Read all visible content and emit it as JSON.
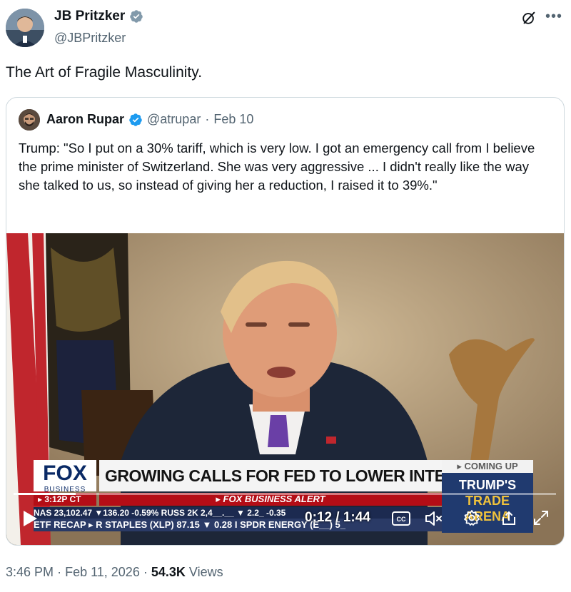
{
  "author": {
    "display_name": "JB Pritzker",
    "handle": "@JBPritzker"
  },
  "tweet": {
    "text": "The Art of Fragile Masculinity."
  },
  "quoted": {
    "display_name": "Aaron Rupar",
    "handle": "@atrupar",
    "separator": "·",
    "date": "Feb 10",
    "text": "Trump: \"So I put on a 30% tariff, which is very low. I got an emergency call from I believe the prime minister of Switzerland. She was very aggressive ... I didn't really like the way she talked to us, so instead of giving her a reduction, I raised it to 39%.\""
  },
  "video": {
    "overlay": {
      "logo": "FOX",
      "logo_sub": "BUSINESS",
      "headline": "GROWING CALLS FOR FED TO LOWER INTEREST RATES",
      "time": "▸ 3:12P CT",
      "alert": "▸ FOX BUSINESS ALERT",
      "ticker_1": "NAS        23,102.47 ▼136.20  -0.59%   RUSS 2K   2,4__.__ ▼ 2.2_  -0.35",
      "ticker_2": "ETF RECAP   ▸ R STAPLES (XLP)  87.15  ▼ 0.28   I  SPDR ENERGY (E__)  5_",
      "coming_up_label": "▸ COMING UP",
      "coming_up_title": "TRUMP'S",
      "coming_up_title2": "TRADE ARENA"
    },
    "time_display": "0:12 / 1:44",
    "progress": 0.115
  },
  "footer": {
    "time": "3:46 PM",
    "separator": "·",
    "date": "Feb 11, 2026",
    "views_count": "54.3K",
    "views_label": "Views"
  },
  "colors": {
    "verified": "#1d9bf0",
    "text_primary": "#0f1419",
    "text_secondary": "#536471",
    "border": "#cfd9de"
  }
}
